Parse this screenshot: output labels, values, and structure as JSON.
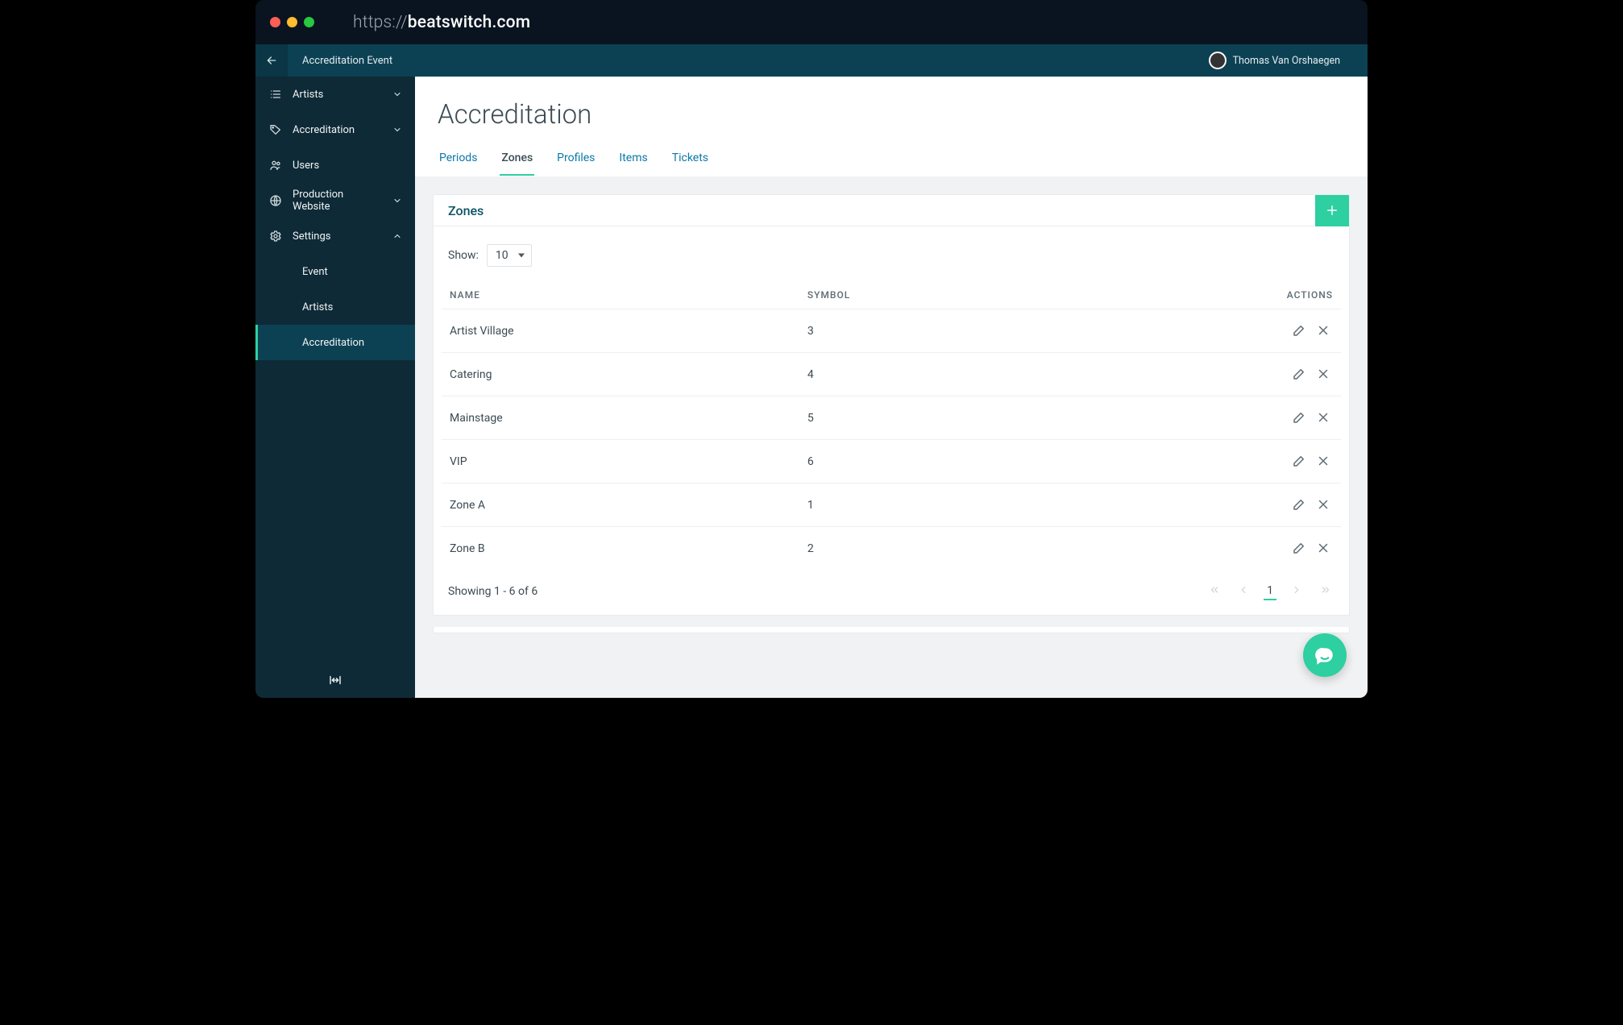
{
  "browser": {
    "protocol": "https://",
    "host": "beatswitch.com"
  },
  "topbar": {
    "breadcrumb": "Accreditation Event",
    "user_name": "Thomas Van Orshaegen"
  },
  "sidebar": {
    "items": [
      {
        "label": "Artists",
        "icon": "list"
      },
      {
        "label": "Accreditation",
        "icon": "tag"
      },
      {
        "label": "Users",
        "icon": "users"
      },
      {
        "label": "Production Website",
        "icon": "globe"
      },
      {
        "label": "Settings",
        "icon": "gear"
      }
    ],
    "settings_children": [
      {
        "label": "Event"
      },
      {
        "label": "Artists"
      },
      {
        "label": "Accreditation"
      }
    ]
  },
  "page": {
    "title": "Accreditation",
    "tabs": [
      "Periods",
      "Zones",
      "Profiles",
      "Items",
      "Tickets"
    ],
    "active_tab": "Zones"
  },
  "panel": {
    "title": "Zones",
    "show_label": "Show:",
    "show_value": "10",
    "columns": {
      "name": "NAME",
      "symbol": "SYMBOL",
      "actions": "ACTIONS"
    },
    "rows": [
      {
        "name": "Artist Village",
        "symbol": "3"
      },
      {
        "name": "Catering",
        "symbol": "4"
      },
      {
        "name": "Mainstage",
        "symbol": "5"
      },
      {
        "name": "VIP",
        "symbol": "6"
      },
      {
        "name": "Zone A",
        "symbol": "1"
      },
      {
        "name": "Zone B",
        "symbol": "2"
      }
    ],
    "footer_text": "Showing 1 - 6 of 6",
    "page_current": "1"
  }
}
